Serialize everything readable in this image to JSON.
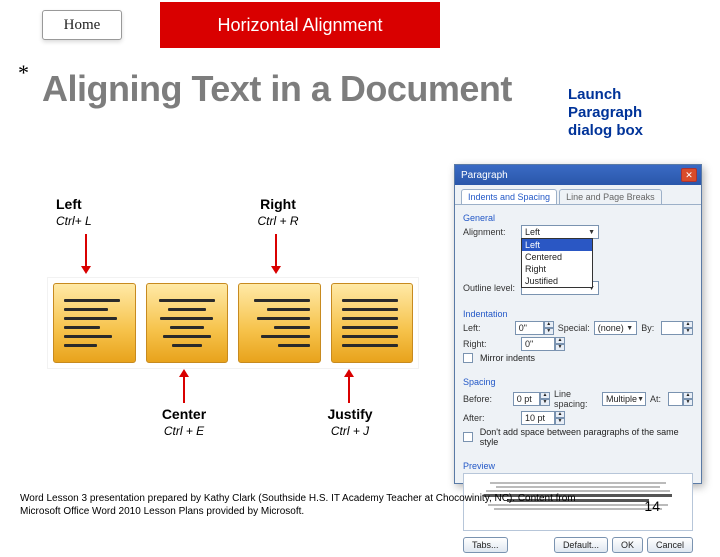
{
  "home_label": "Home",
  "banner": "Horizontal Alignment",
  "asterisk": "*",
  "title": "Aligning Text in a Document",
  "callout": {
    "line1": "Launch",
    "line2": "Paragraph",
    "line3": "dialog box"
  },
  "labels": {
    "left": {
      "name": "Left",
      "shortcut": "Ctrl+ L"
    },
    "right": {
      "name": "Right",
      "shortcut": "Ctrl + R"
    },
    "center": {
      "name": "Center",
      "shortcut": "Ctrl + E"
    },
    "justify": {
      "name": "Justify",
      "shortcut": "Ctrl + J"
    }
  },
  "dialog": {
    "title": "Paragraph",
    "tabs": {
      "active": "Indents and Spacing",
      "other": "Line and Page Breaks"
    },
    "general_label": "General",
    "alignment_label": "Alignment:",
    "alignment_value": "Left",
    "alignment_options": [
      "Left",
      "Centered",
      "Right",
      "Justified"
    ],
    "outline_label": "Outline level:",
    "outline_value": "",
    "indent_label": "Indentation",
    "indent_left_label": "Left:",
    "indent_left_value": "0\"",
    "special_label": "Special:",
    "special_value": "(none)",
    "by_label": "By:",
    "indent_right_label": "Right:",
    "indent_right_value": "0\"",
    "mirror_label": "Mirror indents",
    "spacing_label": "Spacing",
    "before_label": "Before:",
    "before_value": "0 pt",
    "linespacing_label": "Line spacing:",
    "linespacing_value": "Multiple",
    "at_label": "At:",
    "after_label": "After:",
    "after_value": "10 pt",
    "nospace_label": "Don't add space between paragraphs of the same style",
    "preview_label": "Preview",
    "btn_tabs": "Tabs...",
    "btn_default": "Default...",
    "btn_ok": "OK",
    "btn_cancel": "Cancel"
  },
  "footer": "Word Lesson 3 presentation prepared by Kathy Clark (Southside H.S. IT Academy Teacher at Chocowinity, NC). Content from Microsoft Office Word 2010 Lesson Plans provided by Microsoft.",
  "page_number": "14"
}
